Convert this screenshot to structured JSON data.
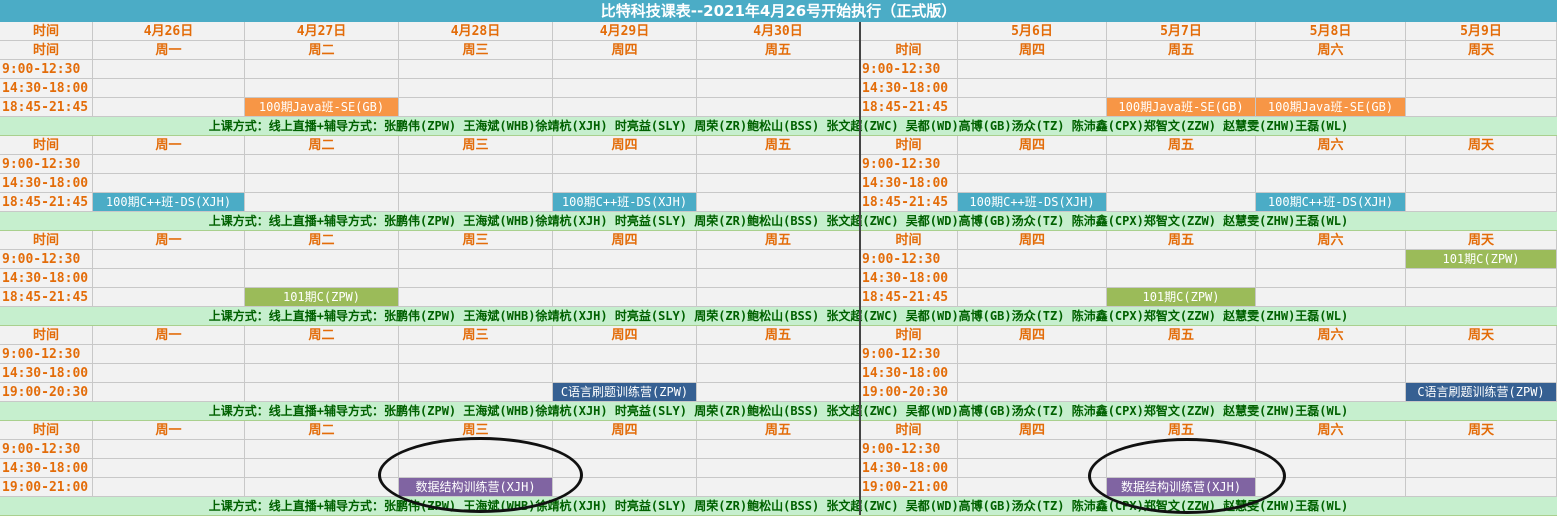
{
  "title": "比特科技课表--2021年4月26号开始执行（正式版）",
  "header_label": "时间",
  "dates_left": [
    "4月26日",
    "4月27日",
    "4月28日",
    "4月29日",
    "4月30日"
  ],
  "dates_right": [
    "5月6日",
    "5月7日",
    "5月8日",
    "5月9日"
  ],
  "weekdays_left": [
    "周一",
    "周二",
    "周三",
    "周四",
    "周五"
  ],
  "weekdays_right": [
    "周四",
    "周五",
    "周六",
    "周天"
  ],
  "note": "上课方式：线上直播+辅导方式：张鹏伟(ZPW) 王海斌(WHB)徐靖杭(XJH) 时亮益(SLY) 周荣(ZR)鲍松山(BSS) 张文超(ZWC) 吴都(WD)高博(GB)汤众(TZ) 陈沛鑫(CPX)郑智文(ZZW) 赵慧雯(ZHW)王磊(WL)",
  "colors": {
    "orange": "#f79646",
    "blue": "#4bacc6",
    "green": "#9bbb59",
    "purple": "#8064a2",
    "steel": "#366092"
  },
  "blocks": [
    {
      "times_left": [
        "9:00-12:30",
        "14:30-18:00",
        "18:45-21:45"
      ],
      "times_right": [
        "9:00-12:30",
        "14:30-18:00",
        "18:45-21:45"
      ],
      "courses": [
        {
          "row": 2,
          "col": 1,
          "text": "100期Java班-SE(GB)",
          "color": "orange"
        },
        {
          "row": 2,
          "col": 6,
          "text": "100期Java班-SE(GB)",
          "color": "orange"
        },
        {
          "row": 2,
          "col": 7,
          "text": "100期Java班-SE(GB)",
          "color": "orange"
        }
      ]
    },
    {
      "times_left": [
        "9:00-12:30",
        "14:30-18:00",
        "18:45-21:45"
      ],
      "times_right": [
        "9:00-12:30",
        "14:30-18:00",
        "18:45-21:45"
      ],
      "courses": [
        {
          "row": 2,
          "col": 0,
          "text": "100期C++班-DS(XJH)",
          "color": "blue"
        },
        {
          "row": 2,
          "col": 3,
          "text": "100期C++班-DS(XJH)",
          "color": "blue"
        },
        {
          "row": 2,
          "col": 5,
          "text": "100期C++班-DS(XJH)",
          "color": "blue"
        },
        {
          "row": 2,
          "col": 7,
          "text": "100期C++班-DS(XJH)",
          "color": "blue"
        }
      ]
    },
    {
      "times_left": [
        "9:00-12:30",
        "14:30-18:00",
        "18:45-21:45"
      ],
      "times_right": [
        "9:00-12:30",
        "14:30-18:00",
        "18:45-21:45"
      ],
      "courses": [
        {
          "row": 2,
          "col": 1,
          "text": "101期C(ZPW)",
          "color": "green"
        },
        {
          "row": 2,
          "col": 6,
          "text": "101期C(ZPW)",
          "color": "green"
        },
        {
          "row": 0,
          "col": 8,
          "text": "101期C(ZPW)",
          "color": "green"
        }
      ]
    },
    {
      "times_left": [
        "9:00-12:30",
        "14:30-18:00",
        "19:00-20:30"
      ],
      "times_right": [
        "9:00-12:30",
        "14:30-18:00",
        "19:00-20:30"
      ],
      "courses": [
        {
          "row": 2,
          "col": 3,
          "text": "C语言刷题训练营(ZPW)",
          "color": "steel"
        },
        {
          "row": 2,
          "col": 8,
          "text": "C语言刷题训练营(ZPW)",
          "color": "steel"
        }
      ]
    },
    {
      "times_left": [
        "9:00-12:30",
        "14:30-18:00",
        "19:00-21:00"
      ],
      "times_right": [
        "9:00-12:30",
        "14:30-18:00",
        "19:00-21:00"
      ],
      "courses": [
        {
          "row": 2,
          "col": 2,
          "text": "数据结构训练营(XJH)",
          "color": "purple"
        },
        {
          "row": 2,
          "col": 6,
          "text": "数据结构训练营(XJH)",
          "color": "purple"
        }
      ]
    }
  ]
}
